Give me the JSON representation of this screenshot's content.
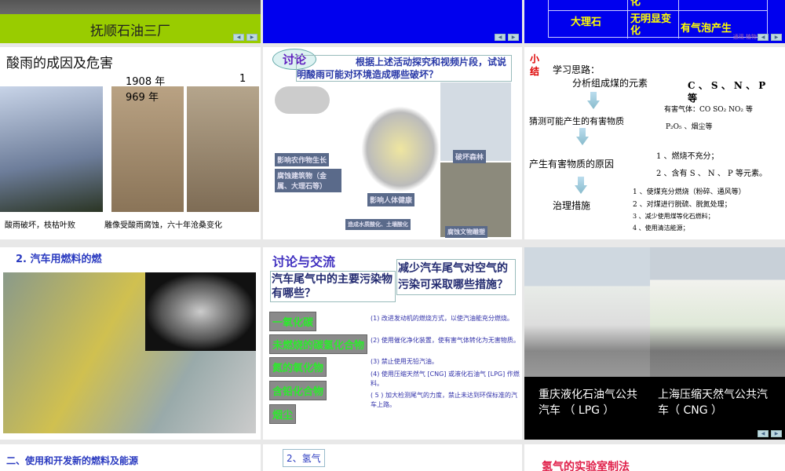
{
  "slides": [
    {
      "title": "抚顺石油三厂"
    },
    {},
    {
      "table": {
        "row_label": "大理石",
        "col1": "无明显变化",
        "col2": "有气泡产生",
        "partial_top": "化",
        "footer": "通观 植物"
      }
    },
    {
      "title": "酸雨的成因及危害",
      "year1": "1908 年",
      "year2_a": "1",
      "year2_b": "969 年",
      "caption_left": "酸雨破坏，枝枯叶败",
      "caption_right": "雕像受酸雨腐蚀，六十年沧桑变化"
    },
    {
      "badge": "讨论",
      "question": "根据上述活动探究和视频片段，试说明酸雨可能对环境造成哪些破坏？",
      "labels": [
        "影响农作物生长",
        "腐蚀建筑物（金属、大理石等）",
        "影响人体健康",
        "破坏森林",
        "造成水质酸化、土壤酸化",
        "腐蚀文物雕塑"
      ]
    },
    {
      "corner": "小结",
      "heading": "学习思路：",
      "steps": [
        "分析组成煤的元素",
        "猜测可能产生的有害物质",
        "产生有害物质的原因",
        "治理措施"
      ],
      "elements": "C 、 S 、 N 、 P 等",
      "harmful": [
        "有害气体：CO SO₂ NO₂ 等",
        "P₂O₅ 、烟尘等"
      ],
      "causes": [
        "1 、燃烧不充分；",
        "2 、含有 S 、 N 、 P 等元素。"
      ],
      "measures": [
        "1 、使煤充分燃烧（粉碎、通风等）",
        "2 、对煤进行脱硫、脱氮处理；",
        "3 、减少使用煤等化石燃料；",
        "4 、使用清洁能源；"
      ]
    },
    {
      "title": "2. 汽车用燃料的燃"
    },
    {
      "heading": "讨论与交流",
      "q1": "汽车尾气中的主要污染物有哪些？",
      "q2": "减少汽车尾气对空气的污染可采取哪些措施？",
      "pollutants": [
        "一氧化碳",
        "未燃烧的碳氢化合物",
        "氮的氧化物",
        "含铅化合物",
        "烟尘"
      ],
      "measures": [
        "(1) 改进发动机的燃烧方式，以使汽油能充分燃烧。",
        "(2) 使用催化净化装置，使有害气体转化为无害物质。",
        "(3) 禁止使用无铅汽油。",
        "(4) 使用压缩天然气 [CNG] 或液化石油气 [LPG] 作燃料。",
        "( 5 ) 加大检测尾气的力度，禁止未达到环保标准的汽车上路。"
      ]
    },
    {
      "caption_left": "重庆液化石油气公共汽车 （ LPG ）",
      "caption_right": "上海压缩天然气公共汽车（ CNG ）"
    },
    {
      "title": "二、使用和开发新的燃料及能源"
    },
    {
      "title": "2、氢气"
    },
    {
      "title": "氢气的实验室制法"
    }
  ],
  "nav": {
    "prev": "◀",
    "next": "▶"
  },
  "colors": {
    "blue": "#0000ee",
    "lime": "#99cc00"
  }
}
